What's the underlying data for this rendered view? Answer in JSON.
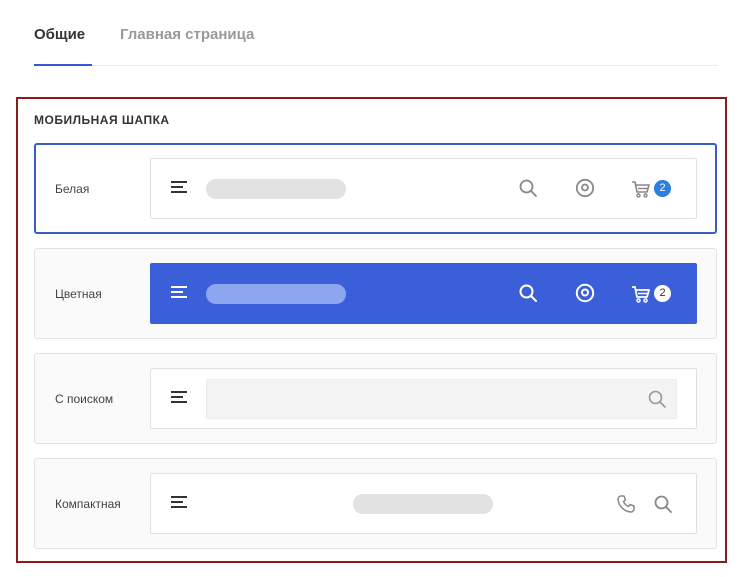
{
  "tabs": [
    {
      "label": "Общие",
      "active": true
    },
    {
      "label": "Главная страница",
      "active": false
    }
  ],
  "section": {
    "title": "МОБИЛЬНАЯ ШАПКА",
    "options": [
      {
        "label": "Белая",
        "selected": true,
        "variant": "white",
        "cart_count": "2"
      },
      {
        "label": "Цветная",
        "selected": false,
        "variant": "colored",
        "cart_count": "2"
      },
      {
        "label": "С поиском",
        "selected": false,
        "variant": "search"
      },
      {
        "label": "Компактная",
        "selected": false,
        "variant": "compact"
      }
    ]
  },
  "colors": {
    "accent": "#3558d9",
    "colored_header": "#3a5fd9",
    "badge": "#2a7fe0",
    "section_border": "#8b1a1a"
  },
  "icons": [
    "menu-icon",
    "search-icon",
    "user-icon",
    "cart-icon",
    "phone-icon"
  ]
}
